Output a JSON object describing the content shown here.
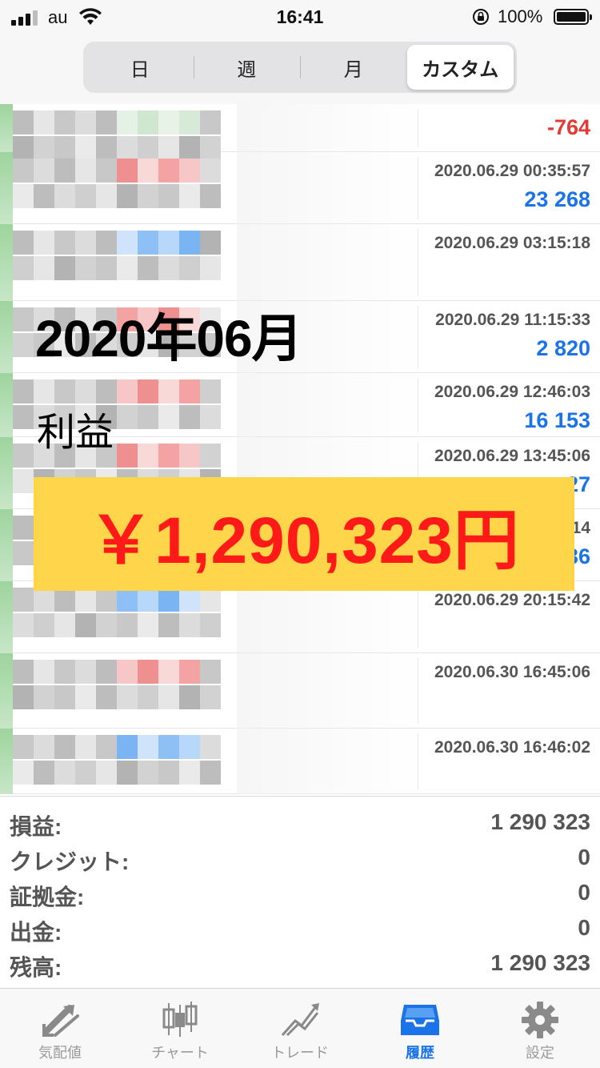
{
  "status_bar": {
    "carrier": "au",
    "time": "16:41",
    "battery": "100%"
  },
  "segmented": {
    "items": [
      "日",
      "週",
      "月",
      "カスタム"
    ],
    "selected": "カスタム"
  },
  "rows": [
    {
      "time": "",
      "profit": "-764",
      "profit_color": "red",
      "marker": "green"
    },
    {
      "time": "2020.06.29 00:35:57",
      "profit": "23 268",
      "profit_color": "blue",
      "marker": "red"
    },
    {
      "time": "2020.06.29 03:15:18",
      "profit": "",
      "profit_color": "",
      "marker": "blue"
    },
    {
      "time": "2020.06.29 11:15:33",
      "profit": "2 820",
      "profit_color": "blue",
      "marker": "red"
    },
    {
      "time": "2020.06.29 12:46:03",
      "profit": "16 153",
      "profit_color": "blue",
      "marker": "red"
    },
    {
      "time": "2020.06.29 13:45:06",
      "profit": "27",
      "profit_color": "blue",
      "marker": "red"
    },
    {
      "time": "14",
      "profit": "36",
      "profit_color": "blue",
      "marker": "red"
    },
    {
      "time": "2020.06.29 20:15:42",
      "profit": "",
      "profit_color": "",
      "marker": "blue"
    },
    {
      "time": "2020.06.30 16:45:06",
      "profit": "",
      "profit_color": "",
      "marker": "red"
    },
    {
      "time": "2020.06.30 16:46:02",
      "profit": "",
      "profit_color": "",
      "marker": "blue"
    }
  ],
  "overlay": {
    "title": "2020年06月",
    "subtitle": "利益",
    "amount": "￥1,290,323円"
  },
  "summary": [
    {
      "label": "損益:",
      "value": "1 290 323"
    },
    {
      "label": "クレジット:",
      "value": "0"
    },
    {
      "label": "証拠金:",
      "value": "0"
    },
    {
      "label": "出金:",
      "value": "0"
    },
    {
      "label": "残高:",
      "value": "1 290 323"
    }
  ],
  "tab_bar": {
    "items": [
      {
        "label": "気配値",
        "icon": "quotes-icon"
      },
      {
        "label": "チャート",
        "icon": "chart-icon"
      },
      {
        "label": "トレード",
        "icon": "trade-icon"
      },
      {
        "label": "履歴",
        "icon": "history-icon"
      },
      {
        "label": "設定",
        "icon": "settings-icon"
      }
    ],
    "selected": "履歴"
  },
  "colors": {
    "accent": "#1a73e8",
    "loss": "#e53935",
    "banner": "#ffd54a",
    "amount": "#ff1a1a"
  }
}
